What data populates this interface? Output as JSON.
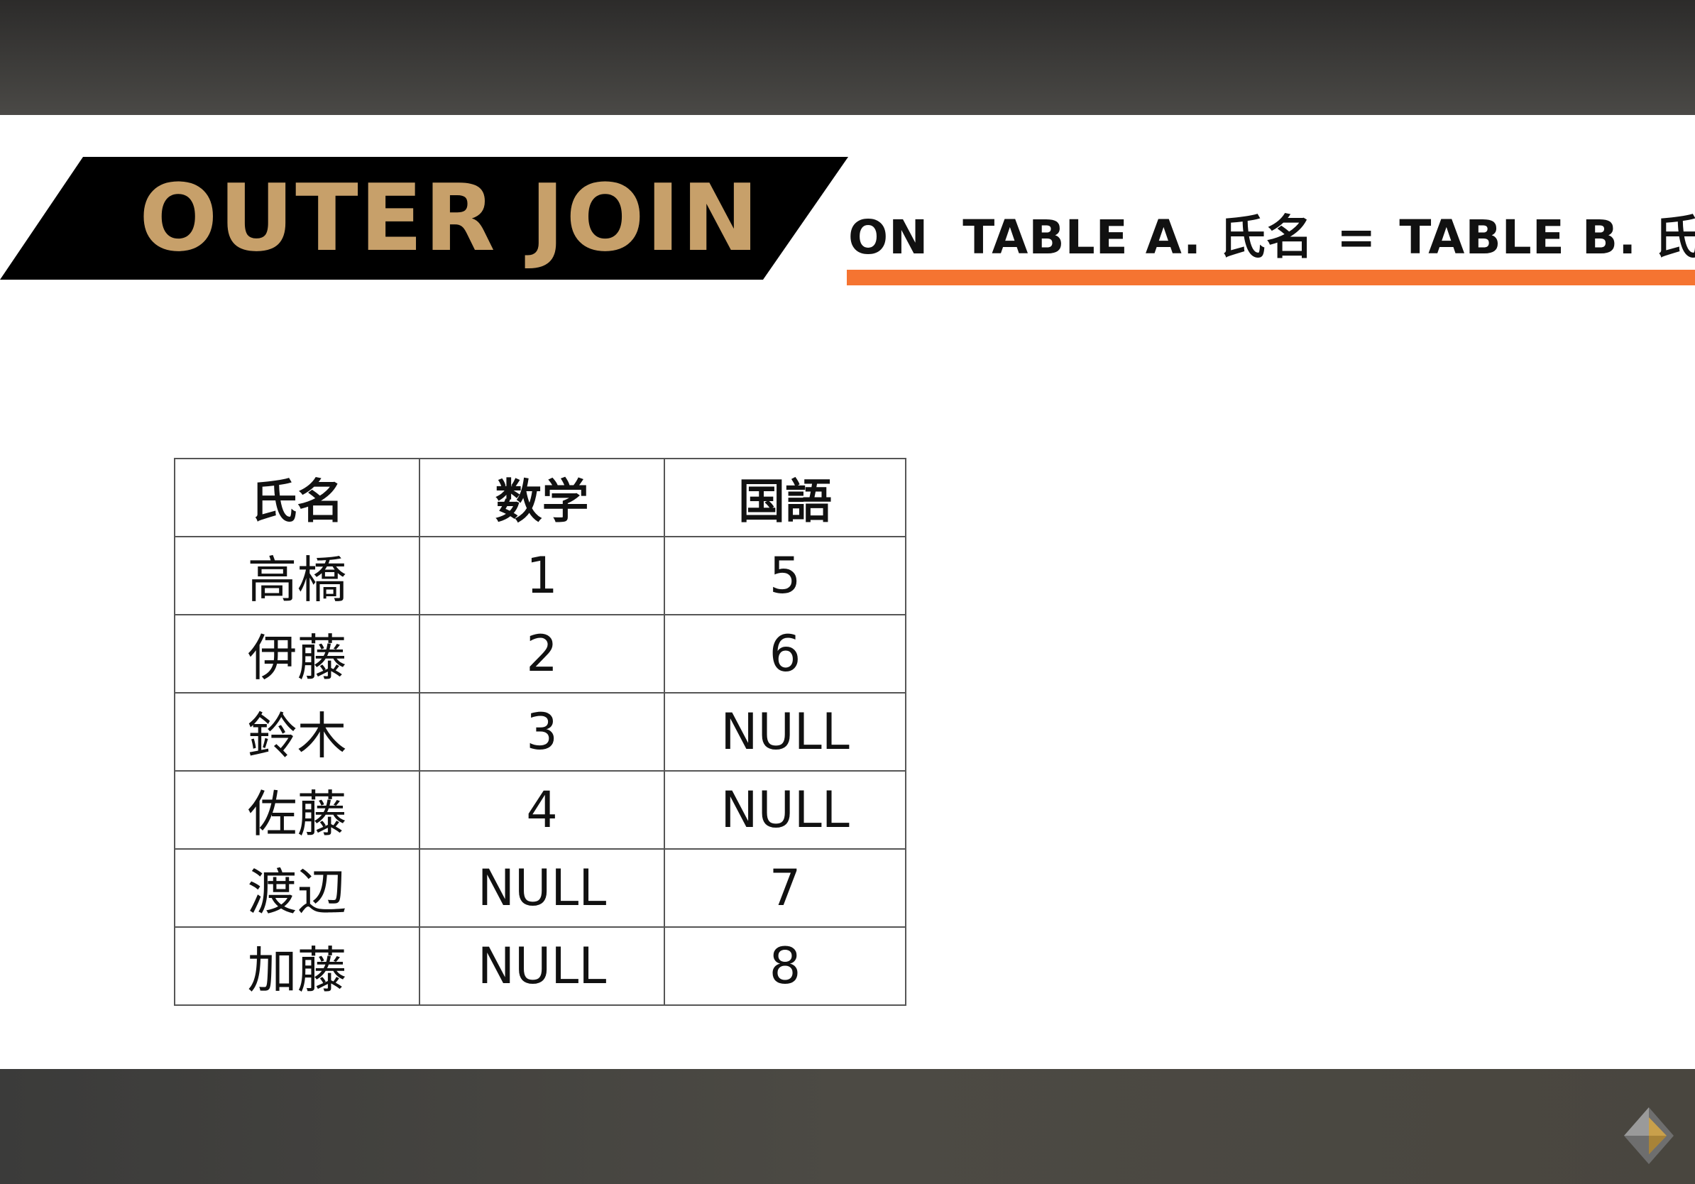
{
  "slide": {
    "title": "OUTER JOIN",
    "on_clause": {
      "left": "ON  TABLE A. 氏名",
      "operator": "=",
      "right": "TABLE B. 氏名"
    }
  },
  "table": {
    "headers": [
      "氏名",
      "数学",
      "国語"
    ],
    "rows": [
      [
        "高橋",
        "1",
        "5"
      ],
      [
        "伊藤",
        "2",
        "6"
      ],
      [
        "鈴木",
        "3",
        "NULL"
      ],
      [
        "佐藤",
        "4",
        "NULL"
      ],
      [
        "渡辺",
        "NULL",
        "7"
      ],
      [
        "加藤",
        "NULL",
        "8"
      ]
    ]
  },
  "colors": {
    "banner": "#000000",
    "title": "#c7a06a",
    "underline": "#f57431",
    "bars": "#404040",
    "logo_gold": "#c9a04b",
    "logo_gray": "#8a8a8a"
  },
  "icons": {
    "logo": "diamond-logo-icon"
  }
}
